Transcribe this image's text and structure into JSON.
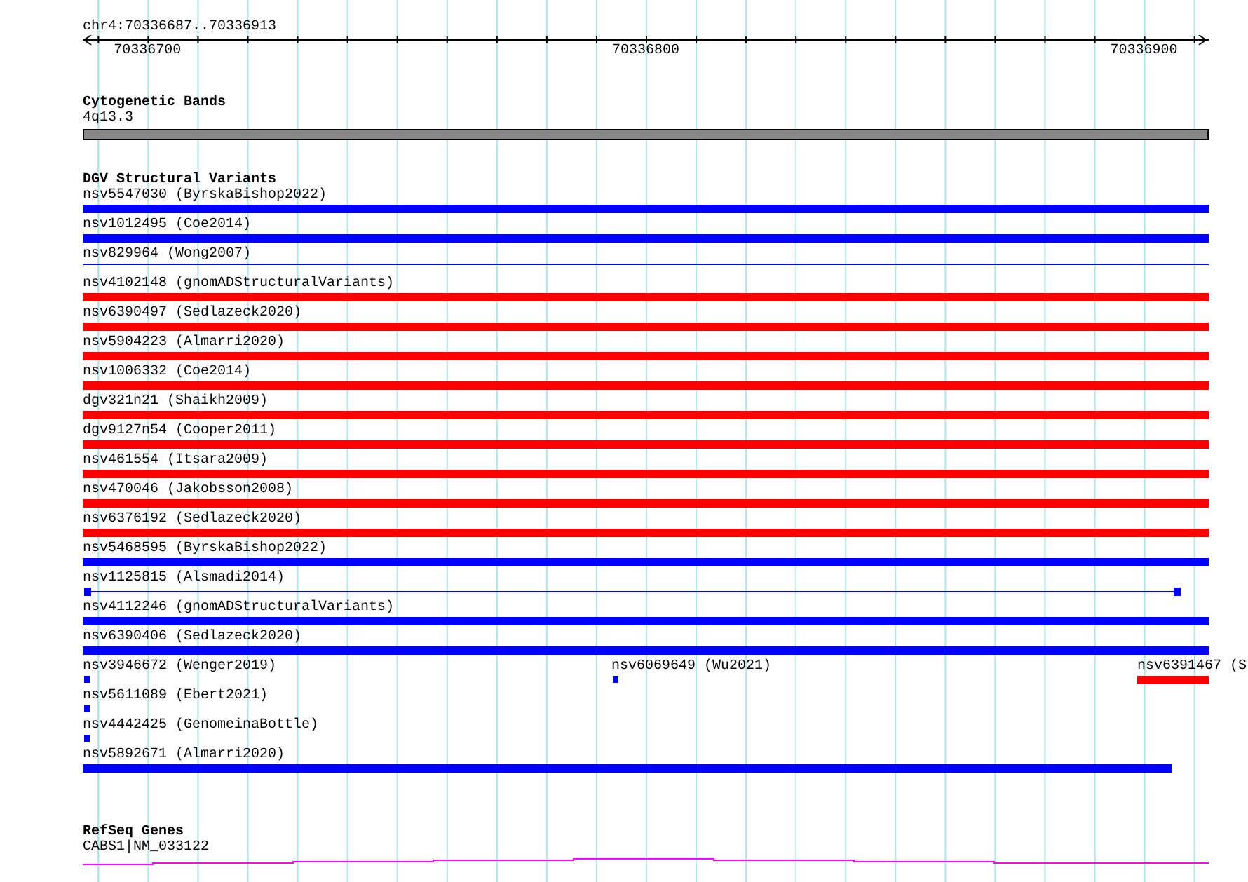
{
  "ruler": {
    "region": "chr4:70336687..70336913",
    "tick_labels": [
      "70336700",
      "70336800",
      "70336900"
    ]
  },
  "cytogenetic_bands": {
    "title": "Cytogenetic Bands",
    "band": {
      "label": "4q13.3",
      "color": "#888888"
    }
  },
  "dgv_structural_variants": {
    "title": "DGV Structural Variants",
    "rows": [
      [
        {
          "label": "nsv5547030 (ByrskaBishop2022)",
          "color": "#0000ff",
          "kind": "bar"
        }
      ],
      [
        {
          "label": "nsv1012495 (Coe2014)",
          "color": "#0000ff",
          "kind": "bar"
        }
      ],
      [
        {
          "label": "nsv829964 (Wong2007)",
          "color": "#0000ff",
          "kind": "line"
        }
      ],
      [
        {
          "label": "nsv4102148 (gnomADStructuralVariants)",
          "color": "#ff0000",
          "kind": "bar"
        }
      ],
      [
        {
          "label": "nsv6390497 (Sedlazeck2020)",
          "color": "#ff0000",
          "kind": "bar"
        }
      ],
      [
        {
          "label": "nsv5904223 (Almarri2020)",
          "color": "#ff0000",
          "kind": "bar"
        }
      ],
      [
        {
          "label": "nsv1006332 (Coe2014)",
          "color": "#ff0000",
          "kind": "bar"
        }
      ],
      [
        {
          "label": "dgv321n21 (Shaikh2009)",
          "color": "#ff0000",
          "kind": "bar"
        }
      ],
      [
        {
          "label": "dgv9127n54 (Cooper2011)",
          "color": "#ff0000",
          "kind": "bar"
        }
      ],
      [
        {
          "label": "nsv461554 (Itsara2009)",
          "color": "#ff0000",
          "kind": "bar"
        }
      ],
      [
        {
          "label": "nsv470046 (Jakobsson2008)",
          "color": "#ff0000",
          "kind": "bar"
        }
      ],
      [
        {
          "label": "nsv6376192 (Sedlazeck2020)",
          "color": "#ff0000",
          "kind": "bar"
        }
      ],
      [
        {
          "label": "nsv5468595 (ByrskaBishop2022)",
          "color": "#0000ff",
          "kind": "bar"
        }
      ],
      [
        {
          "label": "nsv1125815 (Alsmadi2014)",
          "color": "#0000ff",
          "kind": "linked"
        }
      ],
      [
        {
          "label": "nsv4112246 (gnomADStructuralVariants)",
          "color": "#0000ff",
          "kind": "bar"
        }
      ],
      [
        {
          "label": "nsv6390406 (Sedlazeck2020)",
          "color": "#0000ff",
          "kind": "bar"
        }
      ],
      [
        {
          "label": "nsv3946672 (Wenger2019)",
          "color": "#0000ff",
          "kind": "point"
        },
        {
          "label": "nsv6069649 (Wu2021)",
          "color": "#0000ff",
          "kind": "point"
        },
        {
          "label": "nsv6391467 (S",
          "color": "#ff0000",
          "kind": "tail"
        }
      ],
      [
        {
          "label": "nsv5611089 (Ebert2021)",
          "color": "#0000ff",
          "kind": "point"
        }
      ],
      [
        {
          "label": "nsv4442425 (GenomeinaBottle)",
          "color": "#0000ff",
          "kind": "point"
        }
      ],
      [
        {
          "label": "nsv5892671 (Almarri2020)",
          "color": "#0000ff",
          "kind": "long"
        }
      ]
    ]
  },
  "refseq_genes": {
    "title": "RefSeq Genes",
    "gene": {
      "label": "CABS1|NM_033122",
      "color": "#ff00ff"
    }
  }
}
